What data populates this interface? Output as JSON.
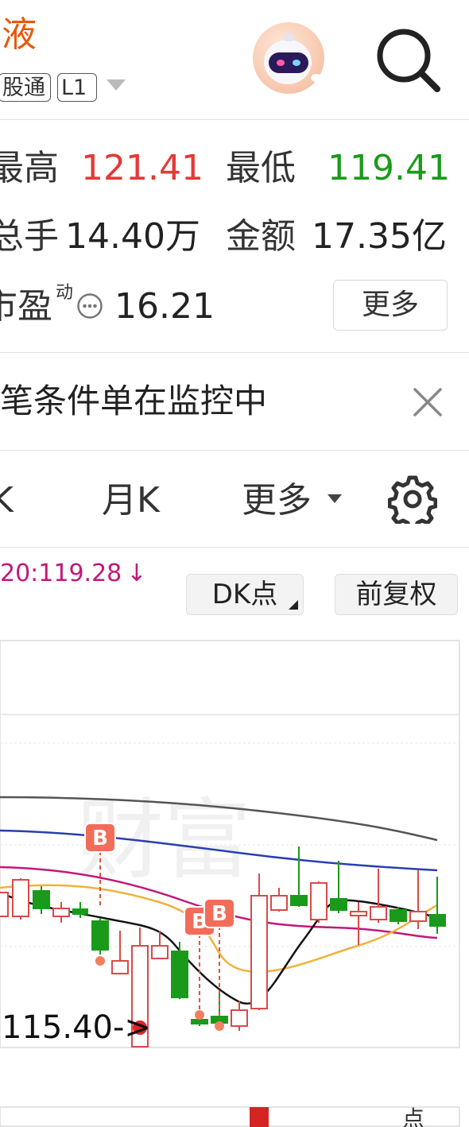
{
  "header": {
    "stock_name": "液",
    "tag_connect": "股通",
    "tag_level": "L1"
  },
  "quote": {
    "high_label": "最高",
    "high_value": "121.41",
    "low_label": "最低",
    "low_value": "119.41",
    "volume_label": "总手",
    "volume_value": "14.40万",
    "amount_label": "金额",
    "amount_value": "17.35亿",
    "pe_label": "市盈",
    "pe_superscript": "动",
    "pe_value": "16.21",
    "more_label": "更多"
  },
  "alert": {
    "text": "笔条件单在监控中"
  },
  "tabs": {
    "partial_left": "K",
    "month": "月K",
    "more": "更多"
  },
  "indicator": {
    "ma_text": "20:119.28",
    "ma_arrow": "↓",
    "dk_label": "DK点",
    "adjust_label": "前复权"
  },
  "chart_data": {
    "type": "candlestick",
    "ma_line_colors": [
      "#555555",
      "#2a3fb0",
      "#c2187a",
      "#f0b23a",
      "#111111"
    ],
    "buy_marker_label": "B",
    "low_marker_label": "115.40->",
    "bottom_partial_label": "点"
  },
  "colors": {
    "up": "#e53935",
    "down": "#1a9a1a",
    "name": "#e8590c",
    "ma_text": "#c2187a"
  }
}
